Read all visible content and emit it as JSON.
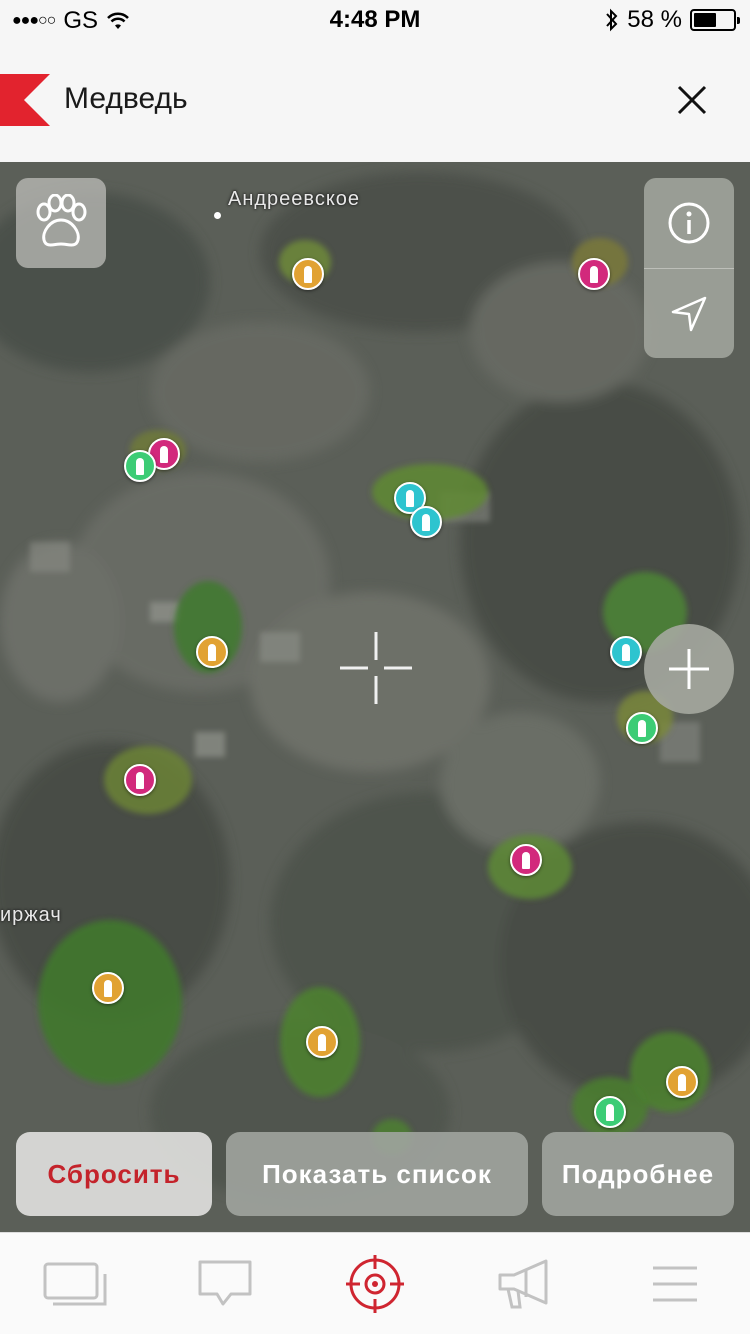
{
  "status_bar": {
    "carrier": "GS",
    "signal_icon": "signal-dots-icon",
    "time": "4:48 PM",
    "battery_percent": "58 %",
    "battery_level": 0.58
  },
  "header": {
    "title": "Медведь",
    "close_icon": "close-icon",
    "accent_color": "#e2232e"
  },
  "map": {
    "place_labels": {
      "village": "Андреевское",
      "town": "иржач"
    },
    "markers": [
      {
        "color": "orange"
      },
      {
        "color": "pink"
      },
      {
        "color": "pink"
      },
      {
        "color": "green"
      },
      {
        "color": "cyan"
      },
      {
        "color": "cyan"
      },
      {
        "color": "orange"
      },
      {
        "color": "cyan"
      },
      {
        "color": "green"
      },
      {
        "color": "pink"
      },
      {
        "color": "pink"
      },
      {
        "color": "orange"
      },
      {
        "color": "orange"
      },
      {
        "color": "orange"
      },
      {
        "color": "green"
      }
    ],
    "marker_colors": {
      "orange": "#e1a233",
      "pink": "#d2297c",
      "cyan": "#2ec4cf",
      "green": "#3ccc75"
    }
  },
  "controls": {
    "reset_label": "Сбросить",
    "show_list_label": "Показать список",
    "more_label": "Подробнее"
  },
  "tabs": [
    {
      "icon": "gallery-icon"
    },
    {
      "icon": "chat-icon"
    },
    {
      "icon": "target-icon",
      "active": true
    },
    {
      "icon": "megaphone-icon"
    },
    {
      "icon": "menu-icon"
    }
  ]
}
